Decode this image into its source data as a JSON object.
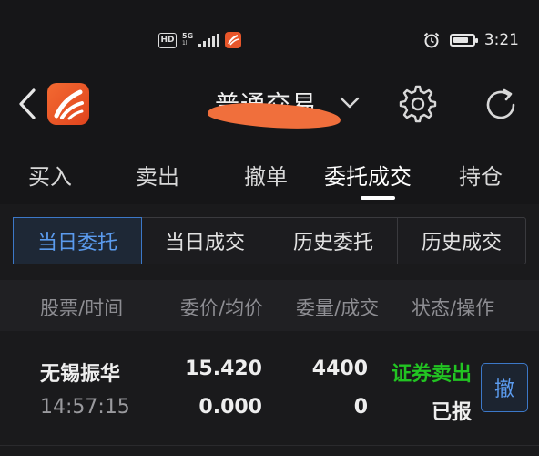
{
  "status_bar": {
    "hd_label": "HD",
    "net_label_top": "5G",
    "net_label_bottom": "1l",
    "time": "3:21",
    "battery_level": 0.8
  },
  "nav": {
    "title": "普通交易"
  },
  "tabs": [
    {
      "label": "买入",
      "active": false
    },
    {
      "label": "卖出",
      "active": false
    },
    {
      "label": "撤单",
      "active": false
    },
    {
      "label": "委托成交",
      "active": true
    },
    {
      "label": "持仓",
      "active": false
    }
  ],
  "segments": [
    {
      "label": "当日委托",
      "active": true
    },
    {
      "label": "当日成交",
      "active": false
    },
    {
      "label": "历史委托",
      "active": false
    },
    {
      "label": "历史成交",
      "active": false
    }
  ],
  "table": {
    "headers": [
      "股票/时间",
      "委价/均价",
      "委量/成交",
      "状态/操作"
    ],
    "rows": [
      {
        "name": "无锡振华",
        "time": "14:57:15",
        "order_price": "15.420",
        "avg_price": "0.000",
        "order_qty": "4400",
        "filled_qty": "0",
        "side": "证券卖出",
        "status": "已报",
        "cancel_label": "撤"
      }
    ]
  },
  "colors": {
    "accent": "#5b9bee",
    "sell": "#22c422",
    "brand": "#f36a32",
    "background": "#1a1a1c"
  }
}
